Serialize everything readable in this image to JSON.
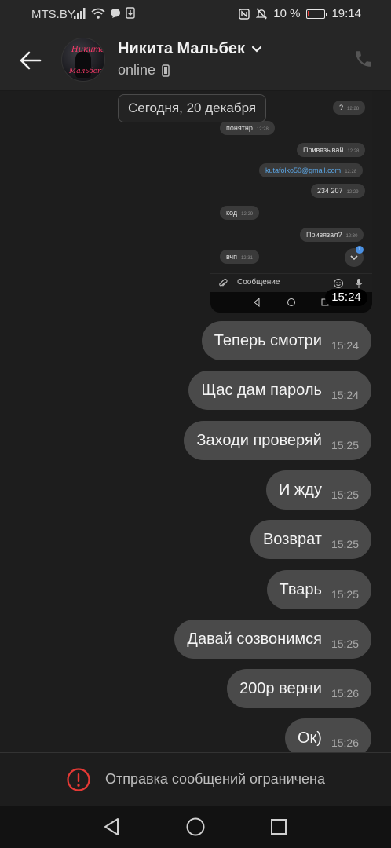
{
  "status_bar": {
    "carrier": "MTS.BY",
    "battery_percent": "10 %",
    "battery_level": 0.1,
    "time": "19:14",
    "icons": [
      "signal-icon",
      "wifi-icon",
      "message-notification-icon",
      "download-icon",
      "nfc-icon",
      "silent-icon",
      "battery-icon"
    ]
  },
  "header": {
    "contact_name": "Никита Мальбек",
    "status": "online",
    "avatar_text_top": "Никита",
    "avatar_text_bottom": "Мальбек",
    "icons": [
      "back-arrow-icon",
      "chevron-down-icon",
      "phone-device-icon",
      "phone-call-icon"
    ]
  },
  "embedded_screenshot": {
    "date_label": "Сегодня, 20 декабря",
    "time_label": "15:24",
    "input_placeholder": "Сообщение",
    "unread_badge": "1",
    "messages": [
      {
        "text": "?",
        "time": "12:28",
        "side": "out"
      },
      {
        "text": "понятнр",
        "time": "12:28",
        "side": "in"
      },
      {
        "text": "Привязывай",
        "time": "12:28",
        "side": "out"
      },
      {
        "text": "kutafolko50@gmail.com",
        "time": "12:28",
        "side": "out",
        "link": true
      },
      {
        "text": "234 207",
        "time": "12:29",
        "side": "out"
      },
      {
        "text": "код",
        "time": "12:29",
        "side": "in"
      },
      {
        "text": "Привязал?",
        "time": "12:30",
        "side": "out"
      },
      {
        "text": "вчп",
        "time": "12:31",
        "side": "in"
      }
    ]
  },
  "messages": [
    {
      "text": "Теперь смотри",
      "time": "15:24"
    },
    {
      "text": "Щас дам пароль",
      "time": "15:24"
    },
    {
      "text": "Заходи проверяй",
      "time": "15:25"
    },
    {
      "text": "И жду",
      "time": "15:25"
    },
    {
      "text": "Возврат",
      "time": "15:25"
    },
    {
      "text": "Тварь",
      "time": "15:25"
    },
    {
      "text": "Давай созвонимся",
      "time": "15:25"
    },
    {
      "text": "200р верни",
      "time": "15:26"
    },
    {
      "text": "Ок)",
      "time": "15:26"
    }
  ],
  "restriction": {
    "text": "Отправка сообщений ограничена",
    "icon": "alert-circle-icon",
    "accent_color": "#e53935"
  },
  "navbar": {
    "icons": [
      "nav-back-icon",
      "nav-home-icon",
      "nav-recents-icon"
    ]
  }
}
